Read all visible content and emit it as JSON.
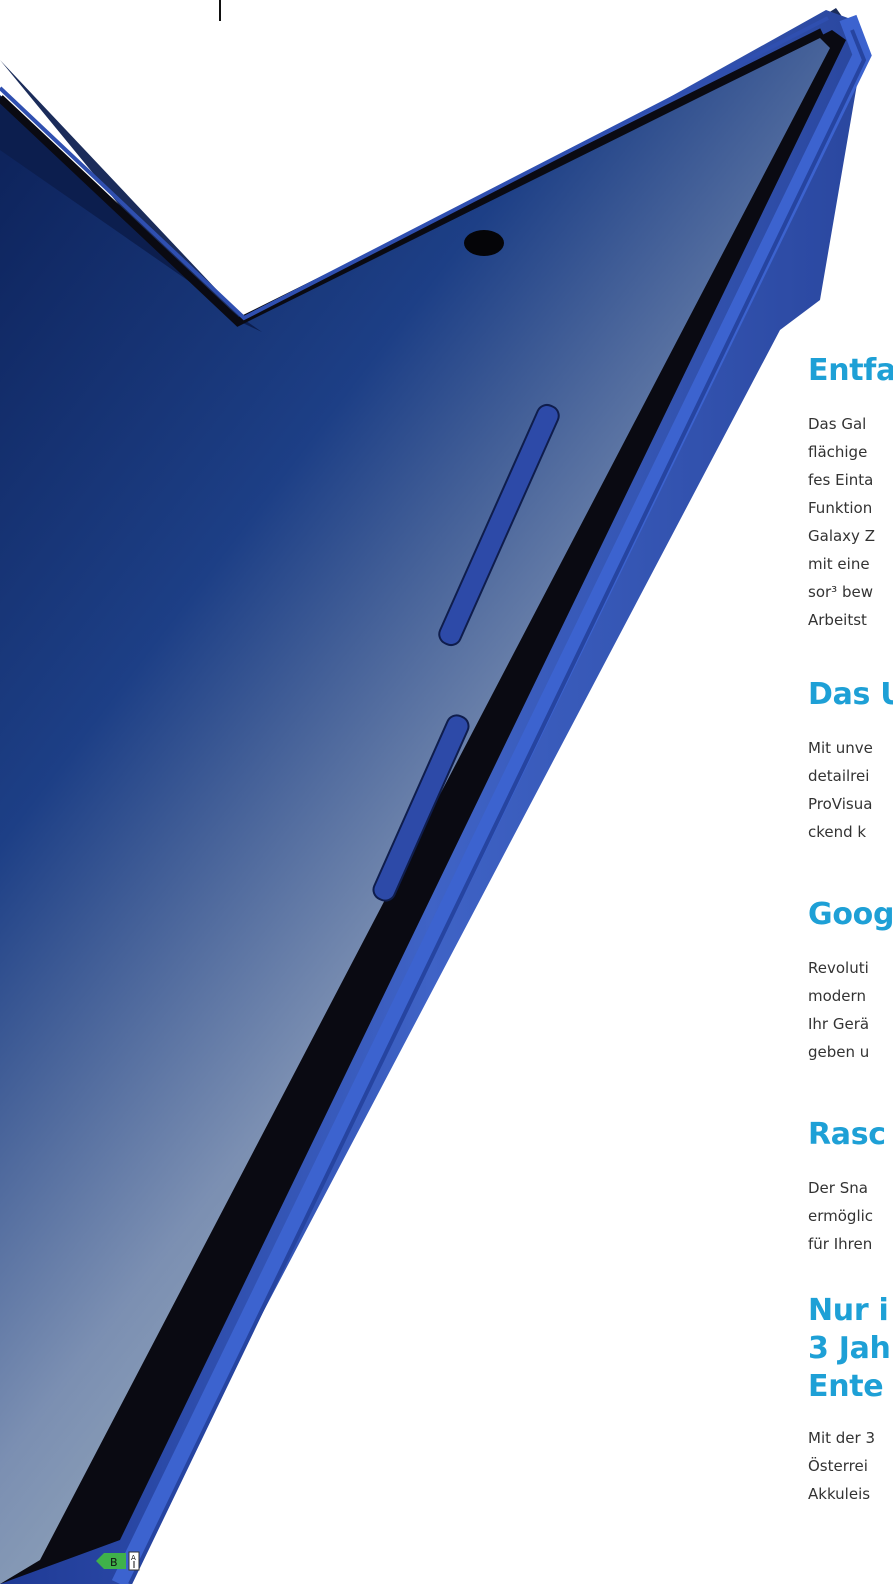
{
  "colors": {
    "heading": "#1ea0d6",
    "body_text": "#333333",
    "phone_frame": "#2f4fb0",
    "screen_dark": "#0d2a6a",
    "screen_light": "#b8c7c8",
    "energy_label_green": "#3fb14a"
  },
  "product_image": {
    "icon": "foldable-phone-image"
  },
  "sections": [
    {
      "heading": "Entfa",
      "lines": [
        "Das Gal",
        "flächige",
        "fes Einta",
        "Funktion",
        "Galaxy Z",
        "mit eine",
        "sor³ bew",
        "Arbeitst"
      ]
    },
    {
      "heading": "Das U",
      "lines": [
        "Mit unve",
        "detailrei",
        "ProVisua",
        "ckend k"
      ]
    },
    {
      "heading": "Goog",
      "lines": [
        "Revoluti",
        "modern",
        "Ihr Gerä",
        "geben u"
      ]
    },
    {
      "heading": "Rasc",
      "lines": [
        "Der Sna",
        "ermöglic",
        "für Ihren"
      ]
    },
    {
      "heading_lines": [
        "Nur i",
        "3 Jah",
        "Ente"
      ],
      "lines": [
        "Mit der 3",
        "Österrei",
        "Akkuleis"
      ]
    }
  ],
  "energy_label": {
    "class": "B",
    "scale_top": "A",
    "icon": "energy-label-icon"
  }
}
